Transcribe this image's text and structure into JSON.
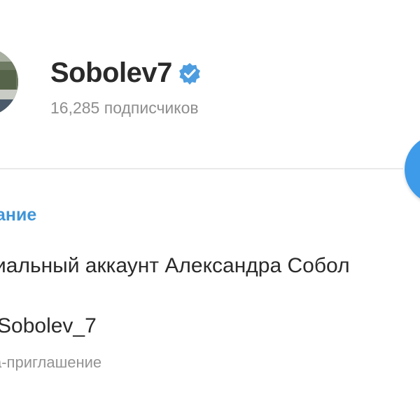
{
  "channel": {
    "name": "Sobolev7",
    "subscribers": "16,285 подписчиков",
    "verified": true,
    "avatar_icon": "channel-avatar-photo"
  },
  "info": {
    "section_title": "ание",
    "description": "иальный аккаунт Александра Собол",
    "username": "Sobolev_7",
    "username_caption": "а-приглашение"
  },
  "colors": {
    "accent": "#3e95d8",
    "fab": "#3e9bea",
    "verified_badge": "#4d9de0",
    "text_primary": "#2a2a2a",
    "text_secondary": "#8e8e8e"
  }
}
